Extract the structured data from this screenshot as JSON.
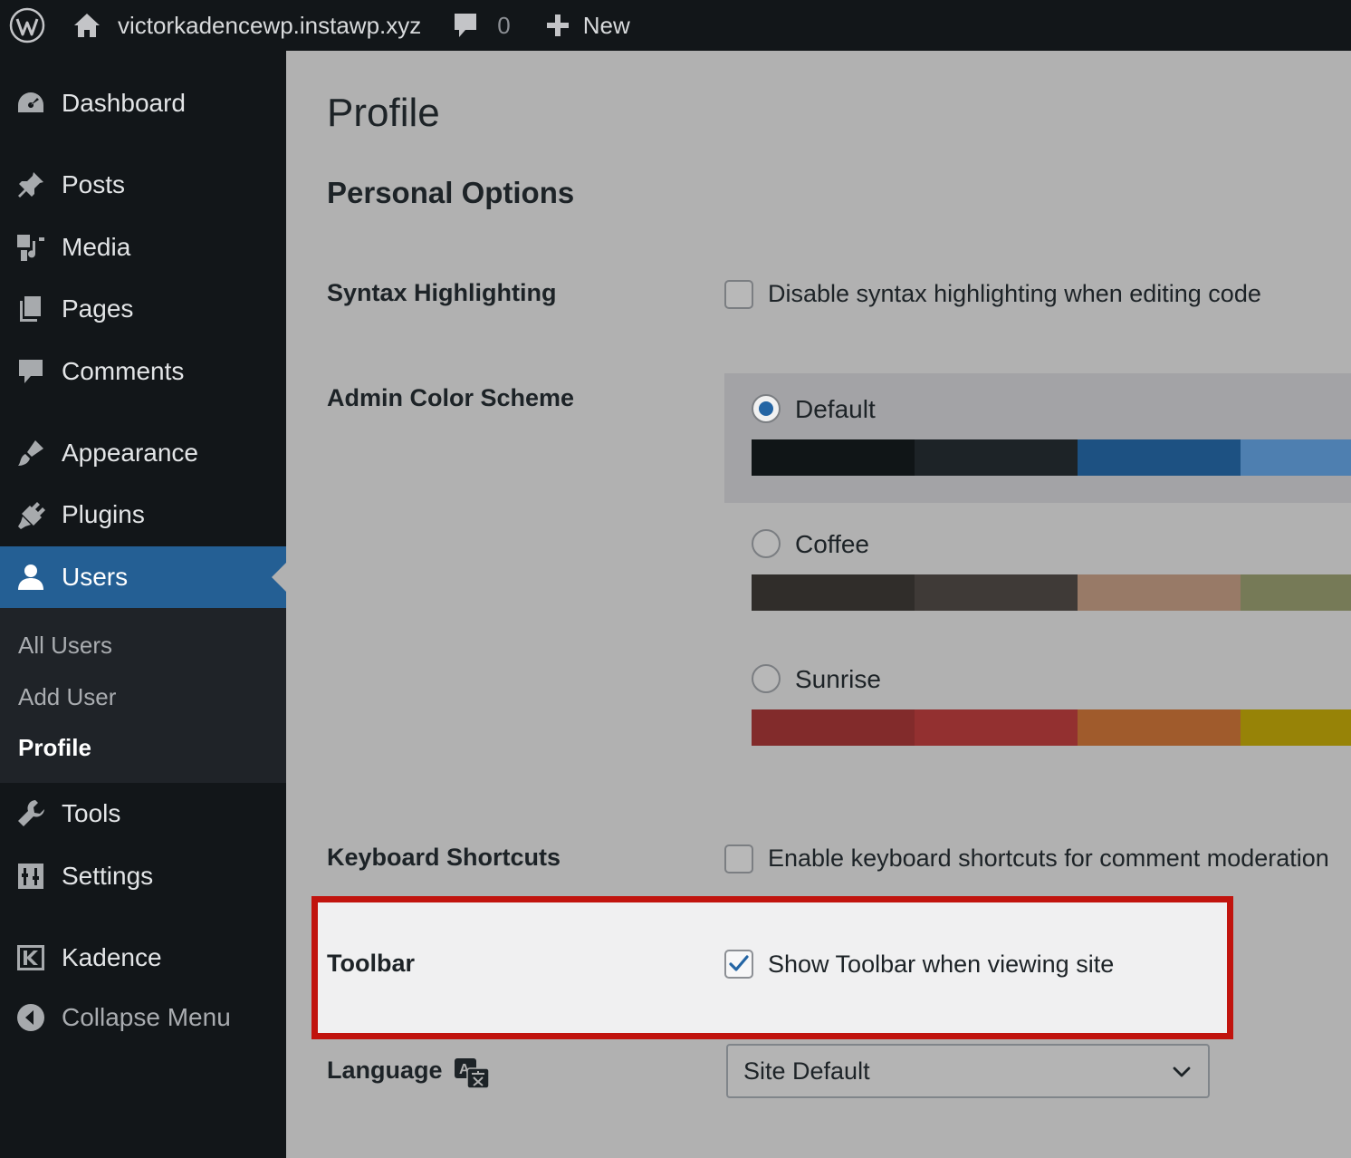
{
  "adminbar": {
    "site_name": "victorkadencewp.instawp.xyz",
    "comments_count": "0",
    "new_label": "New"
  },
  "sidebar": {
    "items": [
      {
        "label": "Dashboard",
        "icon": "dashboard-icon"
      },
      {
        "label": "Posts",
        "icon": "pin-icon"
      },
      {
        "label": "Media",
        "icon": "media-icon"
      },
      {
        "label": "Pages",
        "icon": "pages-icon"
      },
      {
        "label": "Comments",
        "icon": "comment-icon"
      },
      {
        "label": "Appearance",
        "icon": "brush-icon"
      },
      {
        "label": "Plugins",
        "icon": "plugin-icon"
      },
      {
        "label": "Users",
        "icon": "user-icon"
      },
      {
        "label": "Tools",
        "icon": "wrench-icon"
      },
      {
        "label": "Settings",
        "icon": "settings-icon"
      },
      {
        "label": "Kadence",
        "icon": "kadence-icon"
      },
      {
        "label": "Collapse Menu",
        "icon": "collapse-icon"
      }
    ],
    "submenu": [
      {
        "label": "All Users"
      },
      {
        "label": "Add User"
      },
      {
        "label": "Profile"
      }
    ]
  },
  "main": {
    "page_title": "Profile",
    "section_title": "Personal Options",
    "syntax": {
      "label": "Syntax Highlighting",
      "checkbox_label": "Disable syntax highlighting when editing code",
      "checked": false
    },
    "color_scheme": {
      "label": "Admin Color Scheme",
      "schemes": [
        {
          "name": "Default",
          "selected": true,
          "colors": [
            "#101517",
            "#1d2327",
            "#1d5182",
            "#4e7fb0"
          ]
        },
        {
          "name": "Coffee",
          "selected": false,
          "colors": [
            "#302d2a",
            "#3f3a37",
            "#987a67",
            "#767a57"
          ]
        },
        {
          "name": "Sunrise",
          "selected": false,
          "colors": [
            "#822b2b",
            "#933030",
            "#a05b2c",
            "#978307"
          ]
        }
      ]
    },
    "keyboard": {
      "label": "Keyboard Shortcuts",
      "checkbox_label": "Enable keyboard shortcuts for comment moderation",
      "checked": false
    },
    "toolbar": {
      "label": "Toolbar",
      "checkbox_label": "Show Toolbar when viewing site",
      "checked": true
    },
    "language": {
      "label": "Language",
      "selected": "Site Default"
    }
  },
  "colors": {
    "highlight_border": "#c1140e",
    "menu_current": "#245f94",
    "check_blue": "#2465a4"
  }
}
